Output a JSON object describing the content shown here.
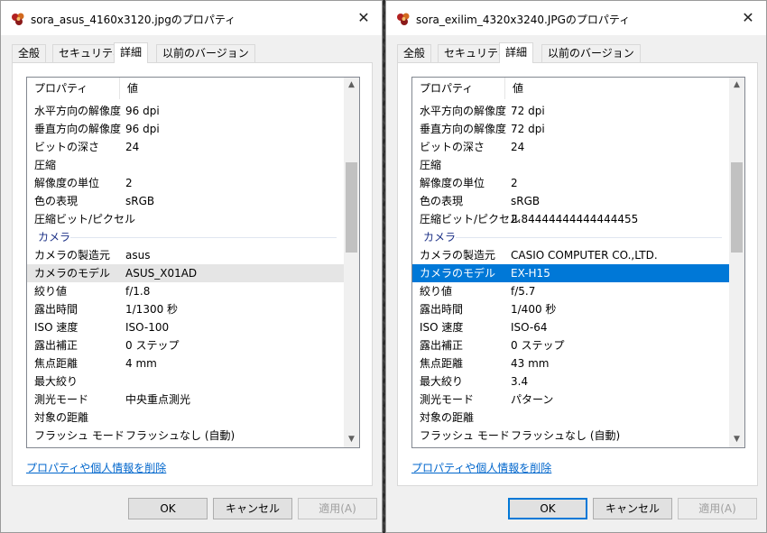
{
  "dialogs": [
    {
      "title": "sora_asus_4160x3120.jpgのプロパティ",
      "tabs": [
        "全般",
        "セキュリティ",
        "詳細",
        "以前のバージョン"
      ],
      "active_tab": 2,
      "header": {
        "property": "プロパティ",
        "value": "値"
      },
      "rows": [
        {
          "name": "水平方向の解像度",
          "value": "96 dpi"
        },
        {
          "name": "垂直方向の解像度",
          "value": "96 dpi"
        },
        {
          "name": "ビットの深さ",
          "value": "24"
        },
        {
          "name": "圧縮",
          "value": ""
        },
        {
          "name": "解像度の単位",
          "value": "2"
        },
        {
          "name": "色の表現",
          "value": "sRGB"
        },
        {
          "name": "圧縮ビット/ピクセル",
          "value": ""
        },
        {
          "group": "カメラ"
        },
        {
          "name": "カメラの製造元",
          "value": "asus"
        },
        {
          "name": "カメラのモデル",
          "value": "ASUS_X01AD",
          "state": "hover"
        },
        {
          "name": "絞り値",
          "value": "f/1.8"
        },
        {
          "name": "露出時間",
          "value": "1/1300 秒"
        },
        {
          "name": "ISO 速度",
          "value": "ISO-100"
        },
        {
          "name": "露出補正",
          "value": "0 ステップ"
        },
        {
          "name": "焦点距離",
          "value": "4 mm"
        },
        {
          "name": "最大絞り",
          "value": ""
        },
        {
          "name": "測光モード",
          "value": "中央重点測光"
        },
        {
          "name": "対象の距離",
          "value": ""
        },
        {
          "name": "フラッシュ モード",
          "value": "フラッシュなし (自動)"
        }
      ],
      "scroll_position": 0.28,
      "remove_link": "プロパティや個人情報を削除",
      "buttons": {
        "ok": "OK",
        "cancel": "キャンセル",
        "apply": "適用(A)"
      },
      "ok_default": false
    },
    {
      "title": "sora_exilim_4320x3240.JPGのプロパティ",
      "tabs": [
        "全般",
        "セキュリティ",
        "詳細",
        "以前のバージョン"
      ],
      "active_tab": 2,
      "header": {
        "property": "プロパティ",
        "value": "値"
      },
      "rows": [
        {
          "name": "水平方向の解像度",
          "value": "72 dpi"
        },
        {
          "name": "垂直方向の解像度",
          "value": "72 dpi"
        },
        {
          "name": "ビットの深さ",
          "value": "24"
        },
        {
          "name": "圧縮",
          "value": ""
        },
        {
          "name": "解像度の単位",
          "value": "2"
        },
        {
          "name": "色の表現",
          "value": "sRGB"
        },
        {
          "name": "圧縮ビット/ピクセル",
          "value": "2.84444444444444455"
        },
        {
          "group": "カメラ"
        },
        {
          "name": "カメラの製造元",
          "value": "CASIO COMPUTER CO.,LTD."
        },
        {
          "name": "カメラのモデル",
          "value": "EX-H15",
          "state": "selected"
        },
        {
          "name": "絞り値",
          "value": "f/5.7"
        },
        {
          "name": "露出時間",
          "value": "1/400 秒"
        },
        {
          "name": "ISO 速度",
          "value": "ISO-64"
        },
        {
          "name": "露出補正",
          "value": "0 ステップ"
        },
        {
          "name": "焦点距離",
          "value": "43 mm"
        },
        {
          "name": "最大絞り",
          "value": "3.4"
        },
        {
          "name": "測光モード",
          "value": "パターン"
        },
        {
          "name": "対象の距離",
          "value": ""
        },
        {
          "name": "フラッシュ モード",
          "value": "フラッシュなし (自動)"
        }
      ],
      "scroll_position": 0.28,
      "remove_link": "プロパティや個人情報を削除",
      "buttons": {
        "ok": "OK",
        "cancel": "キャンセル",
        "apply": "適用(A)"
      },
      "ok_default": true
    }
  ],
  "colors": {
    "selection": "#0078d7",
    "link": "#0066cc",
    "group_label": "#1e3287"
  },
  "icons": {
    "app": "photo-properties-icon",
    "close": "close-icon",
    "scroll_up": "scroll-up-icon",
    "scroll_down": "scroll-down-icon"
  }
}
